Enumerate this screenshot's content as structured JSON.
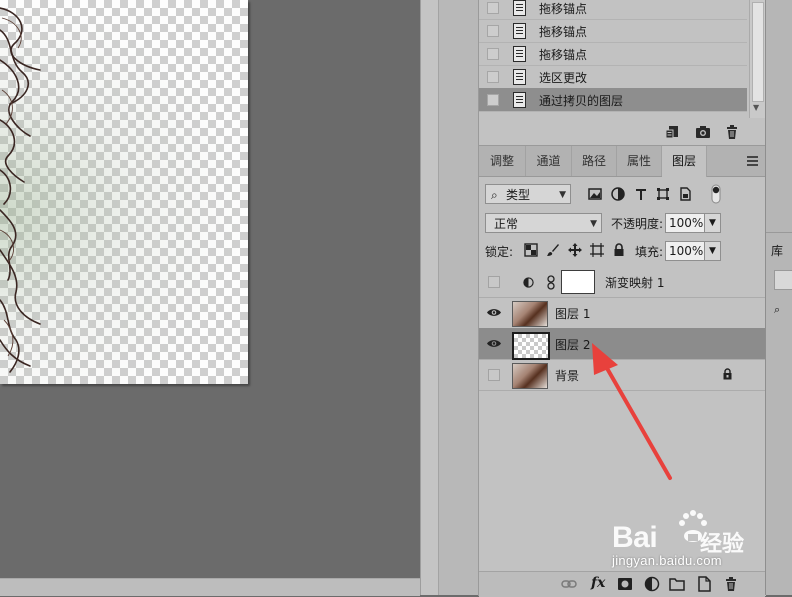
{
  "history": {
    "items": [
      {
        "label": "拖移锚点",
        "selected": false
      },
      {
        "label": "拖移锚点",
        "selected": false
      },
      {
        "label": "拖移锚点",
        "selected": false
      },
      {
        "label": "选区更改",
        "selected": false
      },
      {
        "label": "通过拷贝的图层",
        "selected": true
      }
    ],
    "footer_icons": [
      "new-document-from-state-icon",
      "camera-snapshot-icon",
      "trash-icon"
    ]
  },
  "layers_panel": {
    "tabs": [
      {
        "label": "调整",
        "active": false
      },
      {
        "label": "通道",
        "active": false
      },
      {
        "label": "路径",
        "active": false
      },
      {
        "label": "属性",
        "active": false
      },
      {
        "label": "图层",
        "active": true
      }
    ],
    "filter": {
      "label": "类型",
      "search_glyph": "⌕"
    },
    "blend_mode": "正常",
    "opacity_label": "不透明度:",
    "opacity_value": "100%",
    "lock_label": "锁定:",
    "fill_label": "填充:",
    "fill_value": "100%",
    "layers": [
      {
        "name": "渐变映射 1",
        "visible": false,
        "thumb": "adjustment",
        "selected": false
      },
      {
        "name": "图层 1",
        "visible": true,
        "thumb": "photo",
        "selected": false
      },
      {
        "name": "图层 2",
        "visible": true,
        "thumb": "transparent",
        "selected": true
      },
      {
        "name": "背景",
        "visible": false,
        "thumb": "photo",
        "selected": false,
        "locked": true
      }
    ],
    "footer_icons": [
      "link-icon",
      "fx-icon",
      "mask-icon",
      "adjustment-icon",
      "folder-icon",
      "new-layer-icon",
      "trash-icon"
    ],
    "fx_label": "fx"
  },
  "libraries_panel": {
    "tab_label": "库",
    "search_glyph": "⌕"
  },
  "watermark": {
    "brand": "Bai",
    "brand_suffix": "经验",
    "url": "jingyan.baidu.com"
  },
  "colors": {
    "panel_bg": "#c2c2c2",
    "selected_row": "#8c8c8c",
    "canvas_bg": "#6b6b6b",
    "annotation_arrow": "#e8413c"
  }
}
